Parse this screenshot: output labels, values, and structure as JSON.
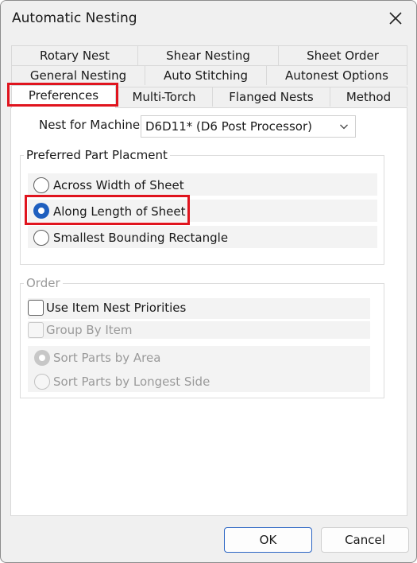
{
  "window": {
    "title": "Automatic Nesting"
  },
  "tabs": {
    "row1": [
      "Rotary Nest",
      "Shear Nesting",
      "Sheet Order"
    ],
    "row2": [
      "General Nesting",
      "Auto Stitching",
      "Autonest Options"
    ],
    "row3": [
      "Preferences",
      "Multi-Torch",
      "Flanged Nests",
      "Method"
    ],
    "active": "Preferences"
  },
  "machine": {
    "label": "Nest for Machine",
    "value": "D6D11* (D6 Post Processor)"
  },
  "placement": {
    "title": "Preferred Part Placment",
    "options": [
      "Across Width of Sheet",
      "Along Length of Sheet",
      "Smallest Bounding Rectangle"
    ],
    "selected": "Along Length of Sheet"
  },
  "order": {
    "title": "Order",
    "use_priorities": "Use Item Nest Priorities",
    "group_by_item": "Group By Item",
    "sort_area": "Sort Parts by Area",
    "sort_longest": "Sort Parts by Longest Side"
  },
  "buttons": {
    "ok": "OK",
    "cancel": "Cancel"
  },
  "colors": {
    "highlight": "#e0141e",
    "accent": "#1f5fbf"
  }
}
